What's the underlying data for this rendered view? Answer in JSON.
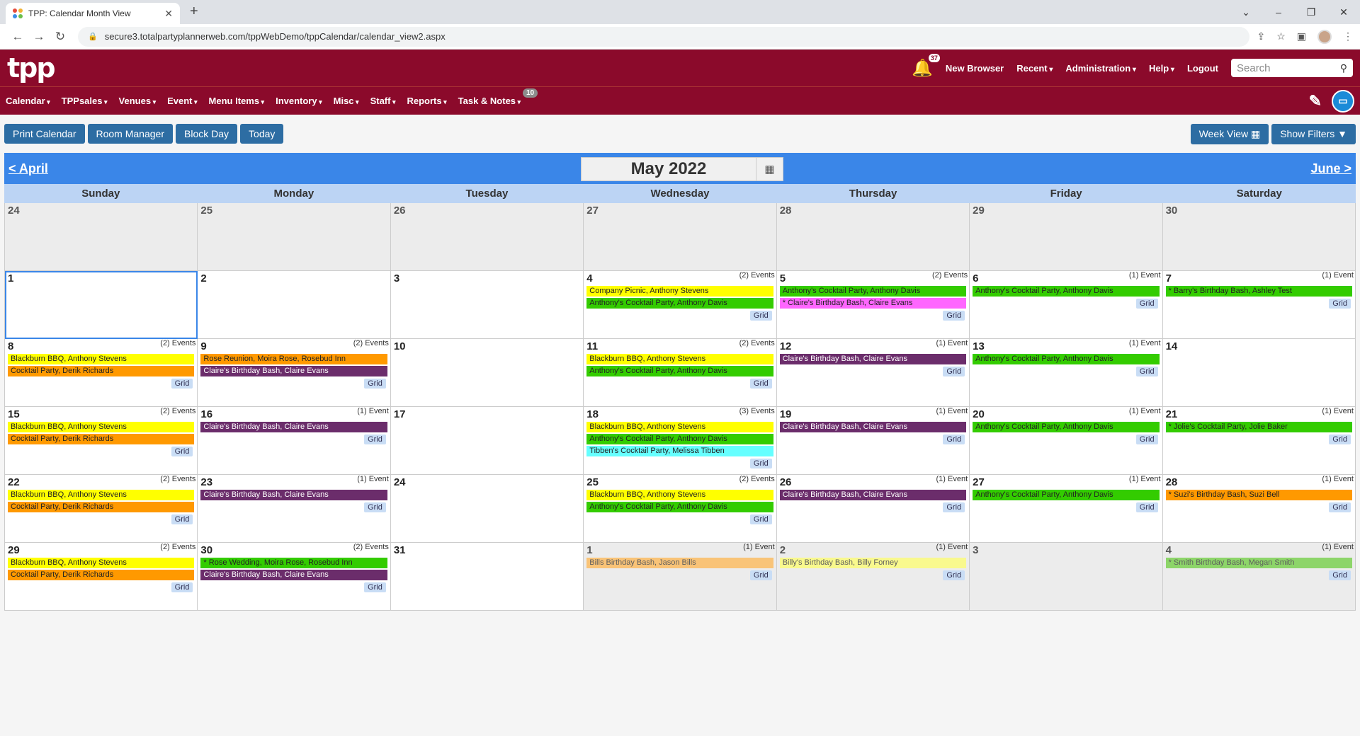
{
  "browser": {
    "tab_title": "TPP: Calendar Month View",
    "url": "secure3.totalpartyplannerweb.com/tppWebDemo/tppCalendar/calendar_view2.aspx"
  },
  "header": {
    "logo": "tpp",
    "notif_count": "37",
    "links": [
      "New Browser",
      "Recent",
      "Administration",
      "Help",
      "Logout"
    ],
    "search_placeholder": "Search"
  },
  "nav": {
    "items": [
      "Calendar",
      "TPPsales",
      "Venues",
      "Event",
      "Menu Items",
      "Inventory",
      "Misc",
      "Staff",
      "Reports",
      "Task & Notes"
    ],
    "task_badge": "10"
  },
  "toolbar": {
    "left": [
      "Print Calendar",
      "Room Manager",
      "Block Day",
      "Today"
    ],
    "week_view": "Week View",
    "show_filters": "Show Filters"
  },
  "calendar": {
    "prev": "< April",
    "next": "June >",
    "title": "May 2022",
    "days": [
      "Sunday",
      "Monday",
      "Tuesday",
      "Wednesday",
      "Thursday",
      "Friday",
      "Saturday"
    ],
    "grid_label": "Grid",
    "colors": {
      "yellow": "#ffff00",
      "green": "#33cc00",
      "orange": "#ff9900",
      "purple": "#6b2d6b",
      "pink": "#ff66ff",
      "cyan": "#66ffff",
      "lightorange": "#ffb347",
      "lightgreen": "#66cc33",
      "paleyellow": "#ffff66"
    },
    "cells": [
      {
        "d": "24",
        "other": true
      },
      {
        "d": "25",
        "other": true
      },
      {
        "d": "26",
        "other": true
      },
      {
        "d": "27",
        "other": true
      },
      {
        "d": "28",
        "other": true
      },
      {
        "d": "29",
        "other": true
      },
      {
        "d": "30",
        "other": true
      },
      {
        "d": "1",
        "today": true
      },
      {
        "d": "2"
      },
      {
        "d": "3"
      },
      {
        "d": "4",
        "count": "(2) Events",
        "events": [
          {
            "t": "Company Picnic, Anthony Stevens",
            "c": "yellow"
          },
          {
            "t": "Anthony's Cocktail Party, Anthony Davis",
            "c": "green"
          }
        ]
      },
      {
        "d": "5",
        "count": "(2) Events",
        "events": [
          {
            "t": "Anthony's Cocktail Party, Anthony Davis",
            "c": "green"
          },
          {
            "t": "* Claire's Birthday Bash, Claire Evans",
            "c": "pink"
          }
        ]
      },
      {
        "d": "6",
        "count": "(1) Event",
        "events": [
          {
            "t": "Anthony's Cocktail Party, Anthony Davis",
            "c": "green"
          }
        ]
      },
      {
        "d": "7",
        "count": "(1) Event",
        "events": [
          {
            "t": "* Barry's Birthday Bash, Ashley Test",
            "c": "green"
          }
        ]
      },
      {
        "d": "8",
        "count": "(2) Events",
        "events": [
          {
            "t": "Blackburn BBQ, Anthony Stevens",
            "c": "yellow"
          },
          {
            "t": "Cocktail Party, Derik Richards",
            "c": "orange"
          }
        ]
      },
      {
        "d": "9",
        "count": "(2) Events",
        "events": [
          {
            "t": "Rose Reunion, Moira Rose, Rosebud Inn",
            "c": "orange"
          },
          {
            "t": "Claire's Birthday Bash, Claire Evans",
            "c": "purple"
          }
        ]
      },
      {
        "d": "10"
      },
      {
        "d": "11",
        "count": "(2) Events",
        "events": [
          {
            "t": "Blackburn BBQ, Anthony Stevens",
            "c": "yellow"
          },
          {
            "t": "Anthony's Cocktail Party, Anthony Davis",
            "c": "green"
          }
        ]
      },
      {
        "d": "12",
        "count": "(1) Event",
        "events": [
          {
            "t": "Claire's Birthday Bash, Claire Evans",
            "c": "purple"
          }
        ]
      },
      {
        "d": "13",
        "count": "(1) Event",
        "events": [
          {
            "t": "Anthony's Cocktail Party, Anthony Davis",
            "c": "green"
          }
        ]
      },
      {
        "d": "14"
      },
      {
        "d": "15",
        "count": "(2) Events",
        "events": [
          {
            "t": "Blackburn BBQ, Anthony Stevens",
            "c": "yellow"
          },
          {
            "t": "Cocktail Party, Derik Richards",
            "c": "orange"
          }
        ]
      },
      {
        "d": "16",
        "count": "(1) Event",
        "events": [
          {
            "t": "Claire's Birthday Bash, Claire Evans",
            "c": "purple"
          }
        ]
      },
      {
        "d": "17"
      },
      {
        "d": "18",
        "count": "(3) Events",
        "events": [
          {
            "t": "Blackburn BBQ, Anthony Stevens",
            "c": "yellow"
          },
          {
            "t": "Anthony's Cocktail Party, Anthony Davis",
            "c": "green"
          },
          {
            "t": "Tibben's Cocktail Party, Melissa Tibben",
            "c": "cyan"
          }
        ]
      },
      {
        "d": "19",
        "count": "(1) Event",
        "events": [
          {
            "t": "Claire's Birthday Bash, Claire Evans",
            "c": "purple"
          }
        ]
      },
      {
        "d": "20",
        "count": "(1) Event",
        "events": [
          {
            "t": "Anthony's Cocktail Party, Anthony Davis",
            "c": "green"
          }
        ]
      },
      {
        "d": "21",
        "count": "(1) Event",
        "events": [
          {
            "t": "* Jolie's Cocktail Party, Jolie Baker",
            "c": "green"
          }
        ]
      },
      {
        "d": "22",
        "count": "(2) Events",
        "events": [
          {
            "t": "Blackburn BBQ, Anthony Stevens",
            "c": "yellow"
          },
          {
            "t": "Cocktail Party, Derik Richards",
            "c": "orange"
          }
        ]
      },
      {
        "d": "23",
        "count": "(1) Event",
        "events": [
          {
            "t": "Claire's Birthday Bash, Claire Evans",
            "c": "purple"
          }
        ]
      },
      {
        "d": "24"
      },
      {
        "d": "25",
        "count": "(2) Events",
        "events": [
          {
            "t": "Blackburn BBQ, Anthony Stevens",
            "c": "yellow"
          },
          {
            "t": "Anthony's Cocktail Party, Anthony Davis",
            "c": "green"
          }
        ]
      },
      {
        "d": "26",
        "count": "(1) Event",
        "events": [
          {
            "t": "Claire's Birthday Bash, Claire Evans",
            "c": "purple"
          }
        ]
      },
      {
        "d": "27",
        "count": "(1) Event",
        "events": [
          {
            "t": "Anthony's Cocktail Party, Anthony Davis",
            "c": "green"
          }
        ]
      },
      {
        "d": "28",
        "count": "(1) Event",
        "events": [
          {
            "t": "* Suzi's Birthday Bash, Suzi Bell",
            "c": "orange"
          }
        ]
      },
      {
        "d": "29",
        "count": "(2) Events",
        "events": [
          {
            "t": "Blackburn BBQ, Anthony Stevens",
            "c": "yellow"
          },
          {
            "t": "Cocktail Party, Derik Richards",
            "c": "orange"
          }
        ]
      },
      {
        "d": "30",
        "count": "(2) Events",
        "events": [
          {
            "t": "* Rose Wedding, Moira Rose, Rosebud Inn",
            "c": "green"
          },
          {
            "t": "Claire's Birthday Bash, Claire Evans",
            "c": "purple"
          }
        ]
      },
      {
        "d": "31"
      },
      {
        "d": "1",
        "other": true,
        "count": "(1) Event",
        "events": [
          {
            "t": "Bills Birthday Bash, Jason Bills",
            "c": "lightorange"
          }
        ]
      },
      {
        "d": "2",
        "other": true,
        "count": "(1) Event",
        "events": [
          {
            "t": "Billy's Birthday Bash, Billy Forney",
            "c": "paleyellow"
          }
        ]
      },
      {
        "d": "3",
        "other": true
      },
      {
        "d": "4",
        "other": true,
        "count": "(1) Event",
        "events": [
          {
            "t": "* Smith Birthday Bash, Megan Smith",
            "c": "lightgreen"
          }
        ]
      }
    ]
  }
}
